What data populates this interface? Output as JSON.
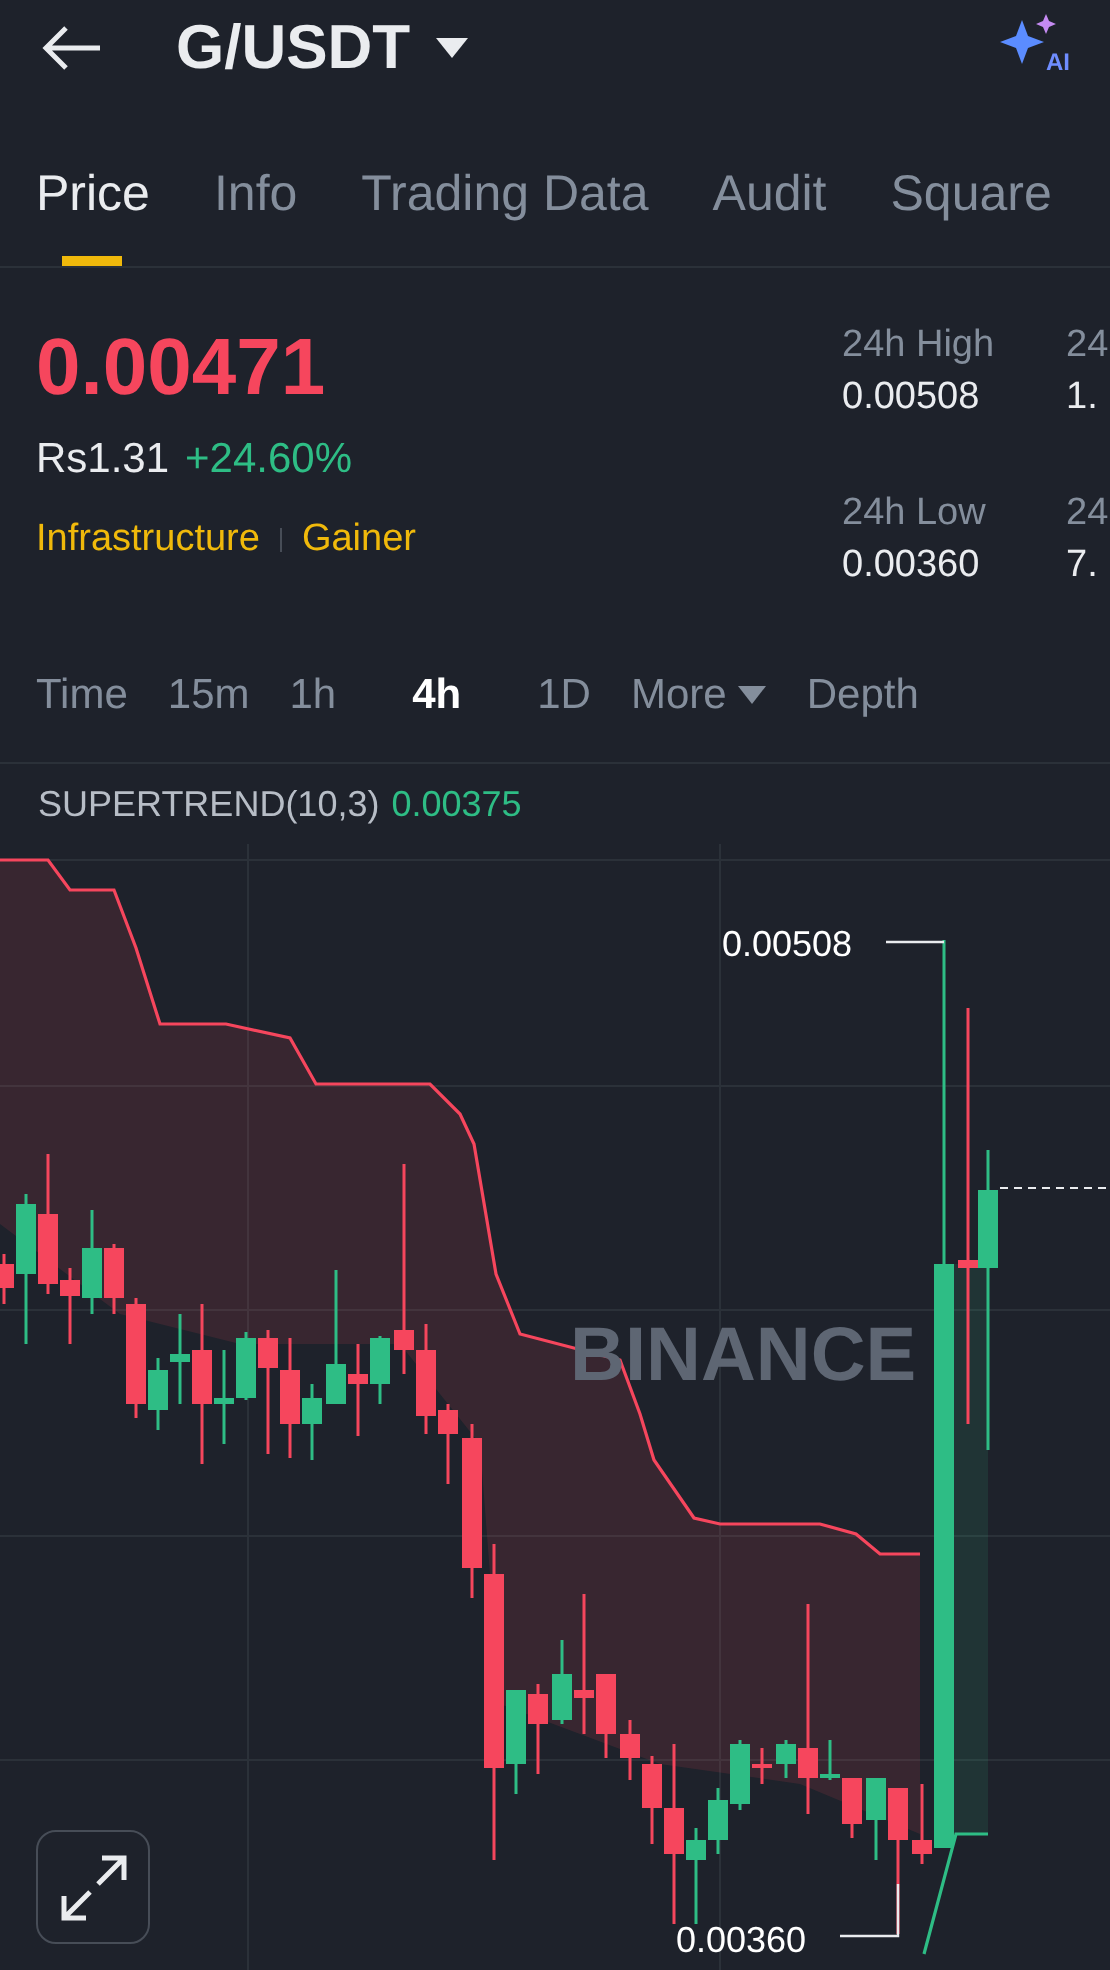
{
  "header": {
    "pair": "G/USDT",
    "ai_badge": "AI"
  },
  "tabs": [
    {
      "label": "Price",
      "selected": true
    },
    {
      "label": "Info",
      "selected": false
    },
    {
      "label": "Trading Data",
      "selected": false
    },
    {
      "label": "Audit",
      "selected": false
    },
    {
      "label": "Square",
      "selected": false
    }
  ],
  "price": {
    "last": "0.00471",
    "local": "Rs1.31",
    "change": "+24.60%",
    "tags": [
      "Infrastructure",
      "Gainer"
    ]
  },
  "stats": [
    {
      "label": "24h High",
      "value": "0.00508"
    },
    {
      "label": "24",
      "value": "1."
    },
    {
      "label": "24h Low",
      "value": "0.00360"
    },
    {
      "label": "24",
      "value": "7."
    }
  ],
  "intervals": [
    {
      "label": "Time",
      "selected": false,
      "kind": "plain"
    },
    {
      "label": "15m",
      "selected": false,
      "kind": "plain"
    },
    {
      "label": "1h",
      "selected": false,
      "kind": "plain"
    },
    {
      "label": "4h",
      "selected": true,
      "kind": "plain"
    },
    {
      "label": "1D",
      "selected": false,
      "kind": "plain"
    },
    {
      "label": "More",
      "selected": false,
      "kind": "dropdown"
    },
    {
      "label": "Depth",
      "selected": false,
      "kind": "plain"
    }
  ],
  "indicator": {
    "name": "SUPERTREND(10,3)",
    "value": "0.00375"
  },
  "chart": {
    "watermark": "BINANCE",
    "high_label": "0.00508",
    "low_label": "0.00360"
  }
}
